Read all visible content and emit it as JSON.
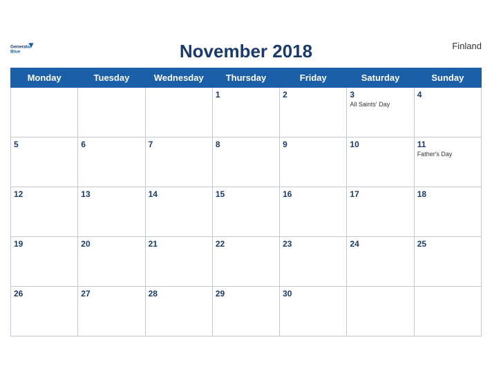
{
  "header": {
    "logo_line1": "General",
    "logo_line2": "Blue",
    "title": "November 2018",
    "country": "Finland"
  },
  "weekdays": [
    "Monday",
    "Tuesday",
    "Wednesday",
    "Thursday",
    "Friday",
    "Saturday",
    "Sunday"
  ],
  "weeks": [
    [
      {
        "day": "",
        "empty": true
      },
      {
        "day": "",
        "empty": true
      },
      {
        "day": "",
        "empty": true
      },
      {
        "day": "1",
        "event": ""
      },
      {
        "day": "2",
        "event": ""
      },
      {
        "day": "3",
        "event": "All Saints' Day"
      },
      {
        "day": "4",
        "event": ""
      }
    ],
    [
      {
        "day": "5",
        "event": ""
      },
      {
        "day": "6",
        "event": ""
      },
      {
        "day": "7",
        "event": ""
      },
      {
        "day": "8",
        "event": ""
      },
      {
        "day": "9",
        "event": ""
      },
      {
        "day": "10",
        "event": ""
      },
      {
        "day": "11",
        "event": "Father's Day"
      }
    ],
    [
      {
        "day": "12",
        "event": ""
      },
      {
        "day": "13",
        "event": ""
      },
      {
        "day": "14",
        "event": ""
      },
      {
        "day": "15",
        "event": ""
      },
      {
        "day": "16",
        "event": ""
      },
      {
        "day": "17",
        "event": ""
      },
      {
        "day": "18",
        "event": ""
      }
    ],
    [
      {
        "day": "19",
        "event": ""
      },
      {
        "day": "20",
        "event": ""
      },
      {
        "day": "21",
        "event": ""
      },
      {
        "day": "22",
        "event": ""
      },
      {
        "day": "23",
        "event": ""
      },
      {
        "day": "24",
        "event": ""
      },
      {
        "day": "25",
        "event": ""
      }
    ],
    [
      {
        "day": "26",
        "event": ""
      },
      {
        "day": "27",
        "event": ""
      },
      {
        "day": "28",
        "event": ""
      },
      {
        "day": "29",
        "event": ""
      },
      {
        "day": "30",
        "event": ""
      },
      {
        "day": "",
        "empty": true
      },
      {
        "day": "",
        "empty": true
      }
    ]
  ]
}
